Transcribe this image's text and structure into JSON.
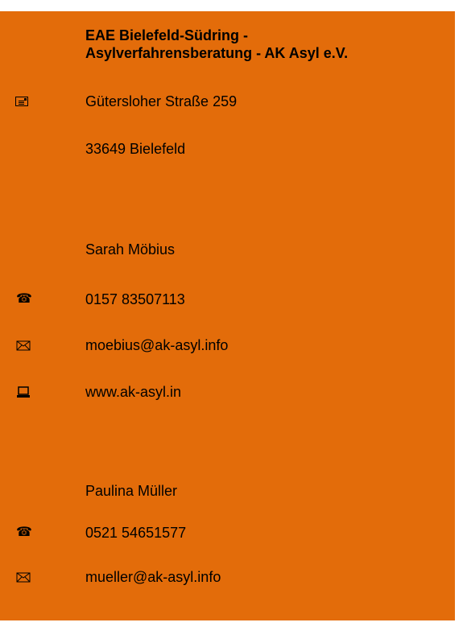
{
  "organization": {
    "title_line1": "EAE Bielefeld-Südring -",
    "title_line2": "Asylverfahrensberatung - AK Asyl e.V."
  },
  "address": {
    "street": "Gütersloher Straße 259",
    "city": "33649 Bielefeld",
    "icon": "address-card-icon"
  },
  "contacts": [
    {
      "name": "Sarah Möbius",
      "phone": "0157 83507113",
      "email": "moebius@ak-asyl.info",
      "website": "www.ak-asyl.in"
    },
    {
      "name": "Paulina Müller",
      "phone": "0521 54651577",
      "email": "mueller@ak-asyl.info"
    }
  ],
  "colors": {
    "background": "#e36c0a",
    "text": "#000000"
  }
}
